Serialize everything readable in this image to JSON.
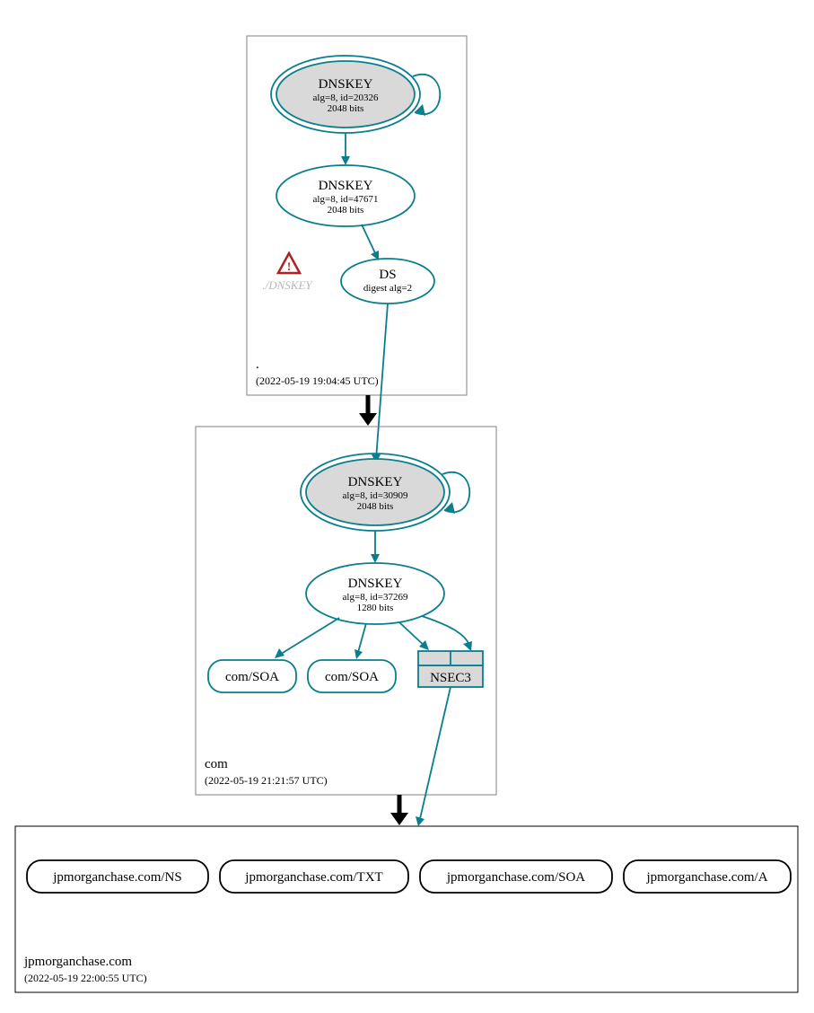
{
  "colors": {
    "teal": "#0a7e8c",
    "grayFill": "#d9d9d9",
    "grayStroke": "#808080",
    "warnRed": "#b02020",
    "warnGray": "#b8b8b8"
  },
  "zones": {
    "root": {
      "name": ".",
      "timestamp": "(2022-05-19 19:04:45 UTC)",
      "ksk": {
        "title": "DNSKEY",
        "line1": "alg=8, id=20326",
        "line2": "2048 bits"
      },
      "zsk": {
        "title": "DNSKEY",
        "line1": "alg=8, id=47671",
        "line2": "2048 bits"
      },
      "ds": {
        "title": "DS",
        "line1": "digest alg=2"
      },
      "warn": "./DNSKEY"
    },
    "com": {
      "name": "com",
      "timestamp": "(2022-05-19 21:21:57 UTC)",
      "ksk": {
        "title": "DNSKEY",
        "line1": "alg=8, id=30909",
        "line2": "2048 bits"
      },
      "zsk": {
        "title": "DNSKEY",
        "line1": "alg=8, id=37269",
        "line2": "1280 bits"
      },
      "soa1": "com/SOA",
      "soa2": "com/SOA",
      "nsec3": "NSEC3"
    },
    "leaf": {
      "name": "jpmorganchase.com",
      "timestamp": "(2022-05-19 22:00:55 UTC)",
      "rr": [
        "jpmorganchase.com/NS",
        "jpmorganchase.com/TXT",
        "jpmorganchase.com/SOA",
        "jpmorganchase.com/A"
      ]
    }
  }
}
